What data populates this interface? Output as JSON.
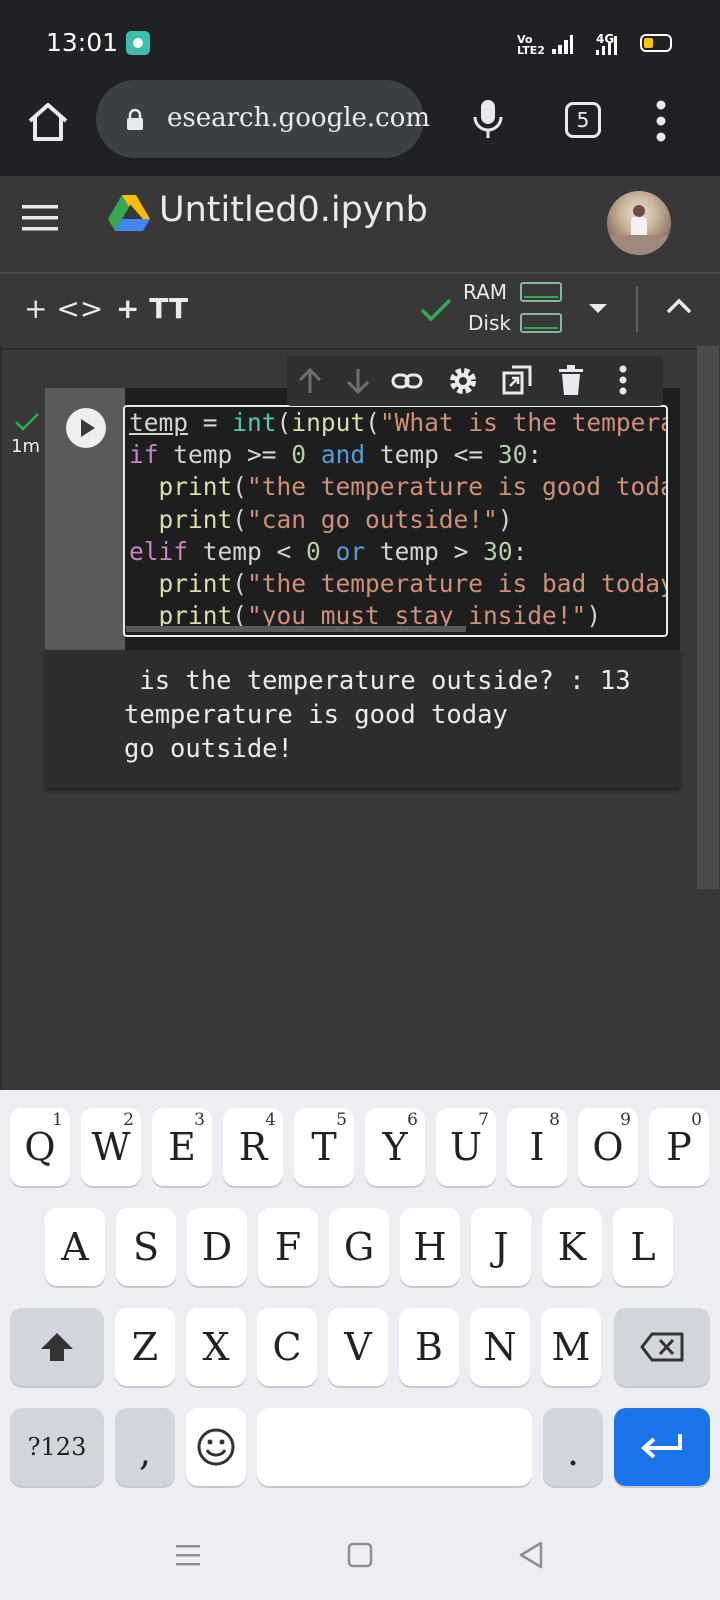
{
  "status_bar": {
    "time": "13:01",
    "volte_line1": "Vo",
    "volte_line2": "LTE2",
    "network_type": "4G"
  },
  "browser": {
    "url": "esearch.google.com",
    "tab_count": "5"
  },
  "colab": {
    "notebook_title": "Untitled0.ipynb",
    "toolbar": {
      "add_code_label": "+ <>",
      "add_text_label": "+ TT"
    },
    "resources": {
      "ram_label": "RAM",
      "disk_label": "Disk"
    },
    "cell": {
      "exec_time": "1m",
      "code": [
        [
          {
            "t": "temp",
            "c": "ul"
          },
          {
            "t": " = ",
            "c": ""
          },
          {
            "t": "int",
            "c": "bi"
          },
          {
            "t": "(",
            "c": ""
          },
          {
            "t": "input",
            "c": "fn"
          },
          {
            "t": "(",
            "c": ""
          },
          {
            "t": "\"What is the temperature outside? : \"",
            "c": "str"
          },
          {
            "t": "))",
            "c": ""
          }
        ],
        [
          {
            "t": "if",
            "c": "kw"
          },
          {
            "t": " temp >= ",
            "c": ""
          },
          {
            "t": "0",
            "c": "num"
          },
          {
            "t": " ",
            "c": ""
          },
          {
            "t": "and",
            "c": "op"
          },
          {
            "t": " temp <= ",
            "c": ""
          },
          {
            "t": "30",
            "c": "num"
          },
          {
            "t": ":",
            "c": ""
          }
        ],
        [
          {
            "t": "  ",
            "c": ""
          },
          {
            "t": "print",
            "c": "fn"
          },
          {
            "t": "(",
            "c": ""
          },
          {
            "t": "\"the temperature is good today\"",
            "c": "str"
          },
          {
            "t": ")",
            "c": ""
          }
        ],
        [
          {
            "t": "  ",
            "c": ""
          },
          {
            "t": "print",
            "c": "fn"
          },
          {
            "t": "(",
            "c": ""
          },
          {
            "t": "\"can go outside!\"",
            "c": "str"
          },
          {
            "t": ")",
            "c": ""
          }
        ],
        [
          {
            "t": "elif",
            "c": "kw"
          },
          {
            "t": " temp < ",
            "c": ""
          },
          {
            "t": "0",
            "c": "num"
          },
          {
            "t": " ",
            "c": ""
          },
          {
            "t": "or",
            "c": "op"
          },
          {
            "t": " temp > ",
            "c": ""
          },
          {
            "t": "30",
            "c": "num"
          },
          {
            "t": ":",
            "c": ""
          }
        ],
        [
          {
            "t": "  ",
            "c": ""
          },
          {
            "t": "print",
            "c": "fn"
          },
          {
            "t": "(",
            "c": ""
          },
          {
            "t": "\"the temperature is bad today\"",
            "c": "str"
          },
          {
            "t": ")",
            "c": ""
          }
        ],
        [
          {
            "t": "  ",
            "c": ""
          },
          {
            "t": "print",
            "c": "fn"
          },
          {
            "t": "(",
            "c": ""
          },
          {
            "t": "\"you must stay inside!\"",
            "c": "str"
          },
          {
            "t": ")",
            "c": ""
          }
        ]
      ],
      "output_lines": [
        " is the temperature outside? : 13",
        "temperature is good today",
        "go outside!"
      ]
    }
  },
  "keyboard": {
    "row1": [
      {
        "label": "Q",
        "hint": "1"
      },
      {
        "label": "W",
        "hint": "2"
      },
      {
        "label": "E",
        "hint": "3"
      },
      {
        "label": "R",
        "hint": "4"
      },
      {
        "label": "T",
        "hint": "5"
      },
      {
        "label": "Y",
        "hint": "6"
      },
      {
        "label": "U",
        "hint": "7"
      },
      {
        "label": "I",
        "hint": "8"
      },
      {
        "label": "O",
        "hint": "9"
      },
      {
        "label": "P",
        "hint": "0"
      }
    ],
    "row2": [
      "A",
      "S",
      "D",
      "F",
      "G",
      "H",
      "J",
      "K",
      "L"
    ],
    "row3": [
      "Z",
      "X",
      "C",
      "V",
      "B",
      "N",
      "M"
    ],
    "symbols_label": "?123",
    "comma_label": ",",
    "period_label": "."
  },
  "icons": {
    "home": "home-icon",
    "lock": "lock-icon",
    "mic": "mic-icon",
    "tabs": "tab-switcher-icon",
    "menu": "more-vert-icon",
    "hamburger": "hamburger-menu-icon",
    "drive": "google-drive-icon",
    "check": "check-icon",
    "cell_toolbar": [
      "arrow-up-icon",
      "arrow-down-icon",
      "link-icon",
      "gear-icon",
      "mirror-cell-icon",
      "trash-icon",
      "more-vert-icon"
    ],
    "run": "play-icon",
    "shift": "shift-icon",
    "backspace": "backspace-icon",
    "emoji": "emoji-icon",
    "enter": "enter-icon"
  },
  "colors": {
    "status_bar_bg": "#202124",
    "colab_bg": "#383838",
    "cell_bg": "#1e1e1e",
    "accent_green": "#34a853",
    "enter_key": "#1a73e8"
  }
}
